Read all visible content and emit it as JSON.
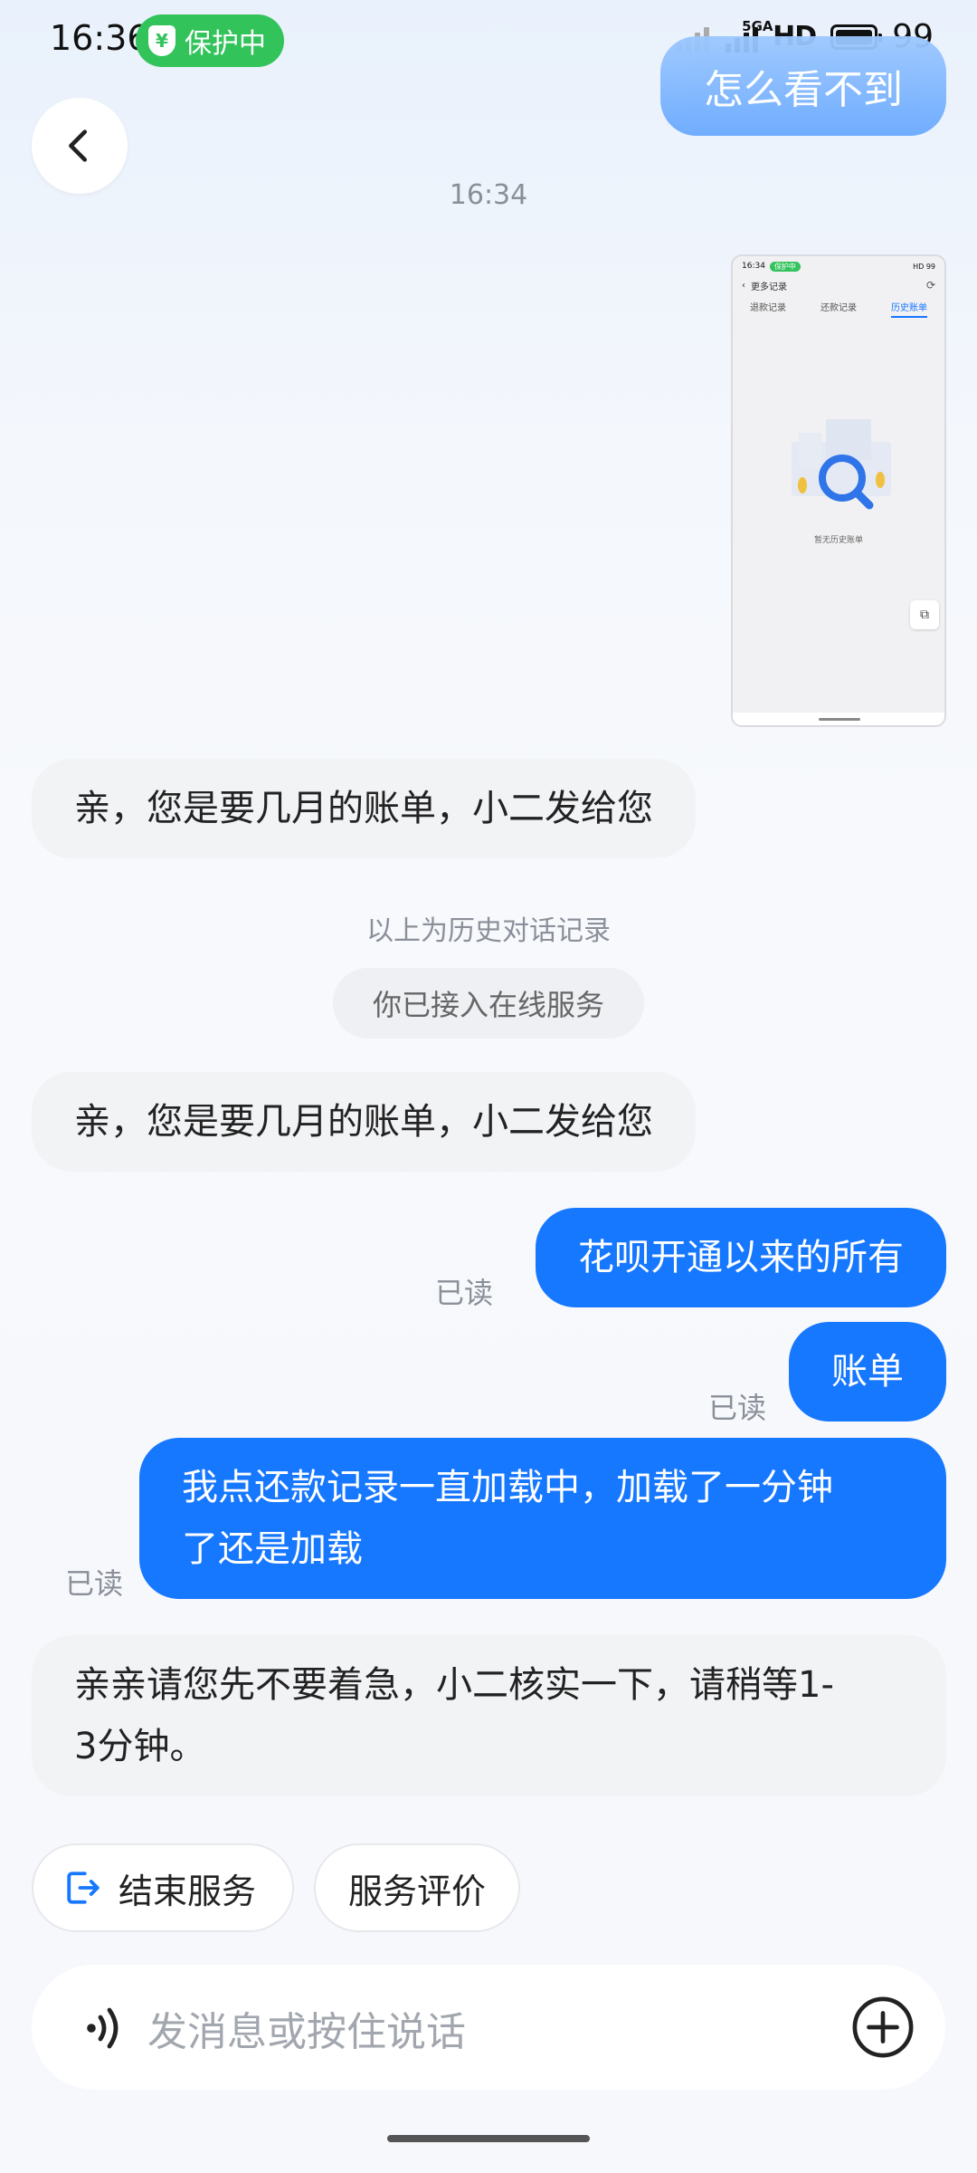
{
  "status_bar": {
    "time": "16:36",
    "protect_label": "保护中",
    "shield_glyph": "¥",
    "network_label": "5GA",
    "hd_label": "HD",
    "battery_level": "99"
  },
  "top_bubble_text": "怎么看不到",
  "timestamp": "16:34",
  "thumbnail": {
    "time": "16:34",
    "pill": "保护中",
    "status_right": "HD 99",
    "nav_title": "更多记录",
    "tabs": [
      "退款记录",
      "还款记录",
      "历史账单"
    ],
    "active_tab_index": 2,
    "empty_text": "暂无历史账单"
  },
  "messages": {
    "m1": "亲，您是要几月的账单，小二发给您",
    "m2": "亲，您是要几月的账单，小二发给您",
    "m3": "花呗开通以来的所有",
    "m4": "账单",
    "m5_line1": "我点还款记录一直加载中，加载了一分钟",
    "m5_line2": "了还是加载",
    "m6_line1": "亲亲请您先不要着急，小二核实一下，请稍等1-",
    "m6_line2": "3分钟。"
  },
  "read_label": "已读",
  "history_notice": "以上为历史对话记录",
  "connected_notice": "你已接入在线服务",
  "actions": {
    "end_service": "结束服务",
    "rate_service": "服务评价"
  },
  "input": {
    "placeholder": "发消息或按住说话"
  },
  "colors": {
    "accent": "#1677ff",
    "protect_green": "#32c35b",
    "left_bubble": "#f2f3f5"
  },
  "icons": [
    "back-arrow-icon",
    "shield-icon",
    "signal-icon",
    "battery-icon",
    "exit-icon",
    "voice-icon",
    "plus-icon"
  ]
}
